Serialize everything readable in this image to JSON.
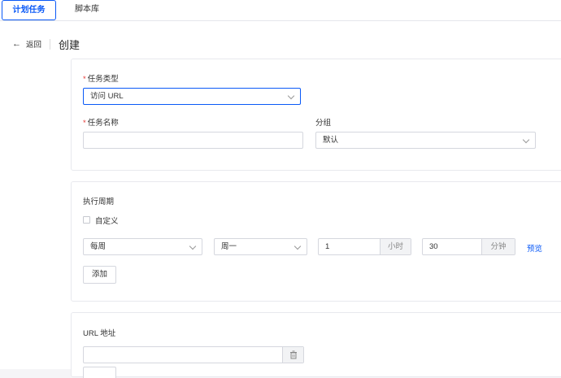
{
  "tabs": [
    {
      "label": "计划任务",
      "active": true
    },
    {
      "label": "脚本库",
      "active": false
    }
  ],
  "header": {
    "back_label": "返回",
    "back_icon": "←",
    "title": "创建"
  },
  "form": {
    "task_type": {
      "label": "任务类型",
      "value": "访问 URL",
      "required": true
    },
    "task_name": {
      "label": "任务名称",
      "value": "",
      "placeholder": "",
      "required": true
    },
    "group": {
      "label": "分组",
      "value": "默认"
    }
  },
  "schedule": {
    "title": "执行周期",
    "custom_label": "自定义",
    "custom_checked": false,
    "frequency": "每周",
    "weekday": "周一",
    "hour_value": "1",
    "hour_unit": "小时",
    "minute_value": "30",
    "minute_unit": "分钟",
    "preview_label": "预览",
    "add_label": "添加"
  },
  "url_section": {
    "title": "URL 地址",
    "value": "",
    "placeholder": ""
  },
  "colors": {
    "accent": "#0a59f7",
    "required": "#e53935"
  }
}
